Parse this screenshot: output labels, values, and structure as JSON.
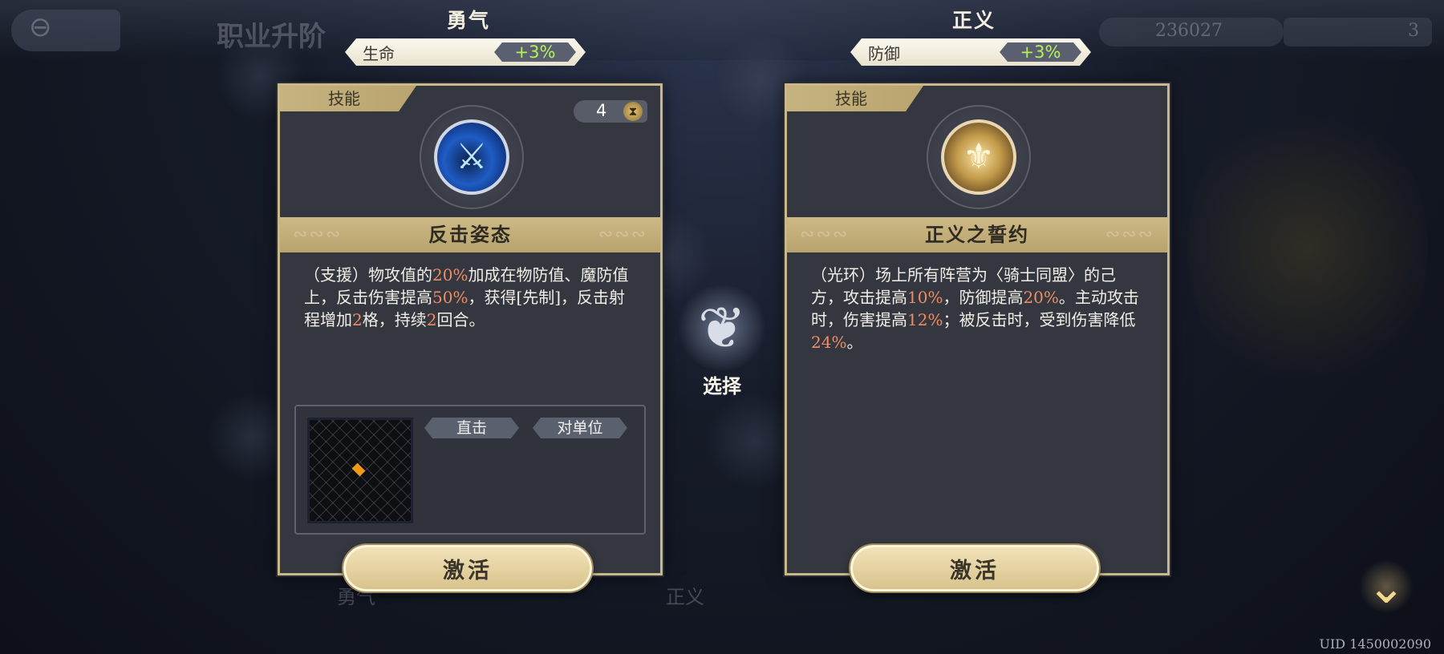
{
  "background": {
    "title": "职业升阶",
    "currency": "236027",
    "stamina": "3",
    "tab_left": "勇气",
    "tab_right": "正义"
  },
  "choices": [
    {
      "path_name": "勇气",
      "stat_label": "生命",
      "stat_bonus": "+3%",
      "tag": "技能",
      "cooldown": "4",
      "icon": "counter-stance-icon",
      "skill_name": "反击姿态",
      "description": [
        {
          "t": "（支援）物攻值的"
        },
        {
          "t": "20%",
          "hl": true
        },
        {
          "t": "加成在物防值、魔防值上，反击伤害提高"
        },
        {
          "t": "50%",
          "hl": true
        },
        {
          "t": "，获得[先制]，反击射程增加"
        },
        {
          "t": "2",
          "hl": true
        },
        {
          "t": "格，持续"
        },
        {
          "t": "2",
          "hl": true
        },
        {
          "t": "回合。"
        }
      ],
      "range_tags": [
        "直击",
        "对单位"
      ],
      "activate_label": "激活"
    },
    {
      "path_name": "正义",
      "stat_label": "防御",
      "stat_bonus": "+3%",
      "tag": "技能",
      "icon": "justice-oath-icon",
      "skill_name": "正义之誓约",
      "description": [
        {
          "t": "（光环）场上所有阵营为〈骑士同盟〉的己方，攻击提高"
        },
        {
          "t": "10%",
          "hl": true
        },
        {
          "t": "，防御提高"
        },
        {
          "t": "20%",
          "hl": true
        },
        {
          "t": "。主动攻击时，伤害提高"
        },
        {
          "t": "12%",
          "hl": true
        },
        {
          "t": "；被反击时，受到伤害降低"
        },
        {
          "t": "24%",
          "hl": true
        },
        {
          "t": "。"
        }
      ],
      "activate_label": "激活"
    }
  ],
  "select_label": "选择",
  "uid": "UID 1450002090",
  "colors": {
    "accent_gold": "#c9b889",
    "highlight": "#f08d62",
    "bonus_green": "#b7f05a"
  }
}
